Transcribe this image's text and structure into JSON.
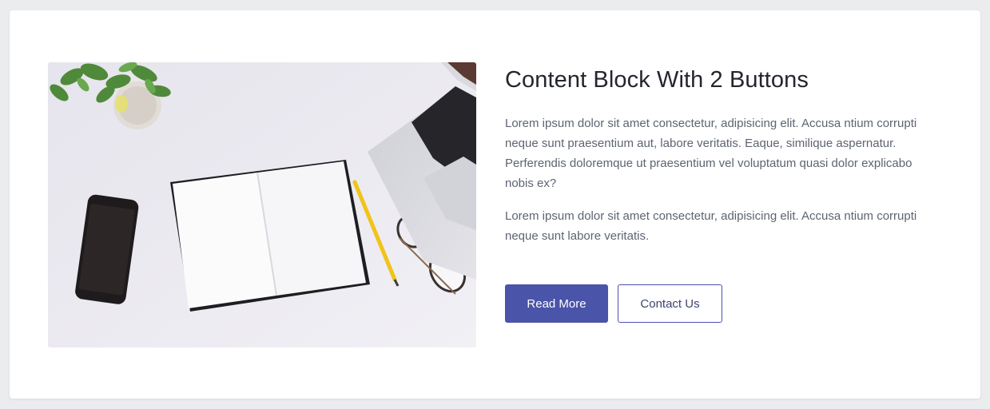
{
  "block": {
    "title": "Content Block With 2 Buttons",
    "paragraph_1": "Lorem ipsum dolor sit amet consectetur, adipisicing elit. Accusa ntium corrupti neque sunt praesentium aut, labore veritatis. Eaque, similique aspernatur. Perferendis doloremque ut praesentium vel voluptatum quasi dolor explicabo nobis ex?",
    "paragraph_2": "Lorem ipsum dolor sit amet consectetur, adipisicing elit. Accusa ntium corrupti neque sunt labore veritatis.",
    "buttons": {
      "primary_label": "Read More",
      "secondary_label": "Contact Us"
    }
  },
  "colors": {
    "accent": "#4a54a8",
    "page_background": "#ebecee",
    "card_background": "#ffffff",
    "title_text": "#23262d",
    "body_text": "#5d6470"
  }
}
